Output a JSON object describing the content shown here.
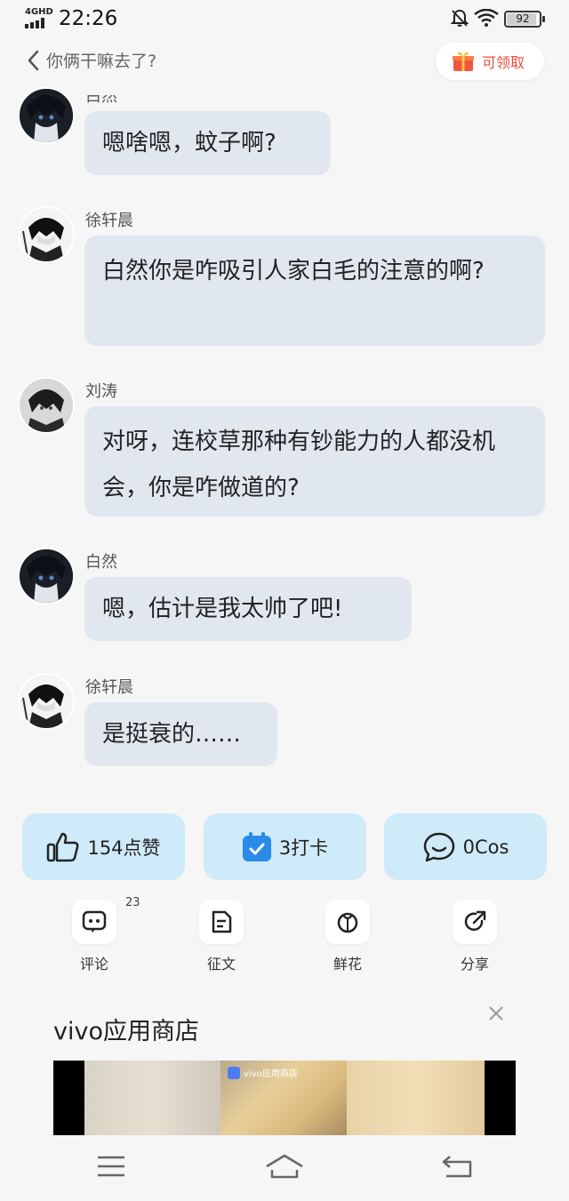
{
  "status_bar": {
    "network": "4GHD",
    "time": "22:26",
    "battery": "92",
    "battery_level": 0.92
  },
  "header": {
    "title": "你俩干嘛去了?",
    "claim_label": "可领取"
  },
  "messages": [
    {
      "sender": "白然",
      "text": "嗯啥嗯，蚊子啊?"
    },
    {
      "sender": "徐轩晨",
      "text": "白然你是咋吸引人家白毛的注意的啊?"
    },
    {
      "sender": "刘涛",
      "text": "对呀，连校草那种有钞能力的人都没机会，你是咋做道的?"
    },
    {
      "sender": "白然",
      "text": "嗯，估计是我太帅了吧!"
    },
    {
      "sender": "徐轩晨",
      "text": "是挺衰的……"
    }
  ],
  "actions": {
    "like_label": "154点赞",
    "checkin_label": "3打卡",
    "cos_label": "0Cos"
  },
  "tools": {
    "comment_label": "评论",
    "comment_count": "23",
    "essay_label": "征文",
    "flower_label": "鲜花",
    "share_label": "分享"
  },
  "ad": {
    "title": "vivo应用商店",
    "overlay_text": "vivo应用商店"
  },
  "colors": {
    "bubble": "#e1e7ef",
    "action_button": "#cfeaf8",
    "claim_text": "#ef4b3c",
    "checkin_icon": "#2a8be8"
  },
  "icons": [
    "signal-icon",
    "mute-bell-icon",
    "wifi-icon",
    "battery-icon",
    "back-chevron-icon",
    "gift-icon",
    "thumbs-up-icon",
    "calendar-check-icon",
    "chat-bubble-icon",
    "comment-icon",
    "document-icon",
    "flower-icon",
    "share-icon",
    "close-icon",
    "menu-icon",
    "home-icon",
    "return-icon"
  ]
}
